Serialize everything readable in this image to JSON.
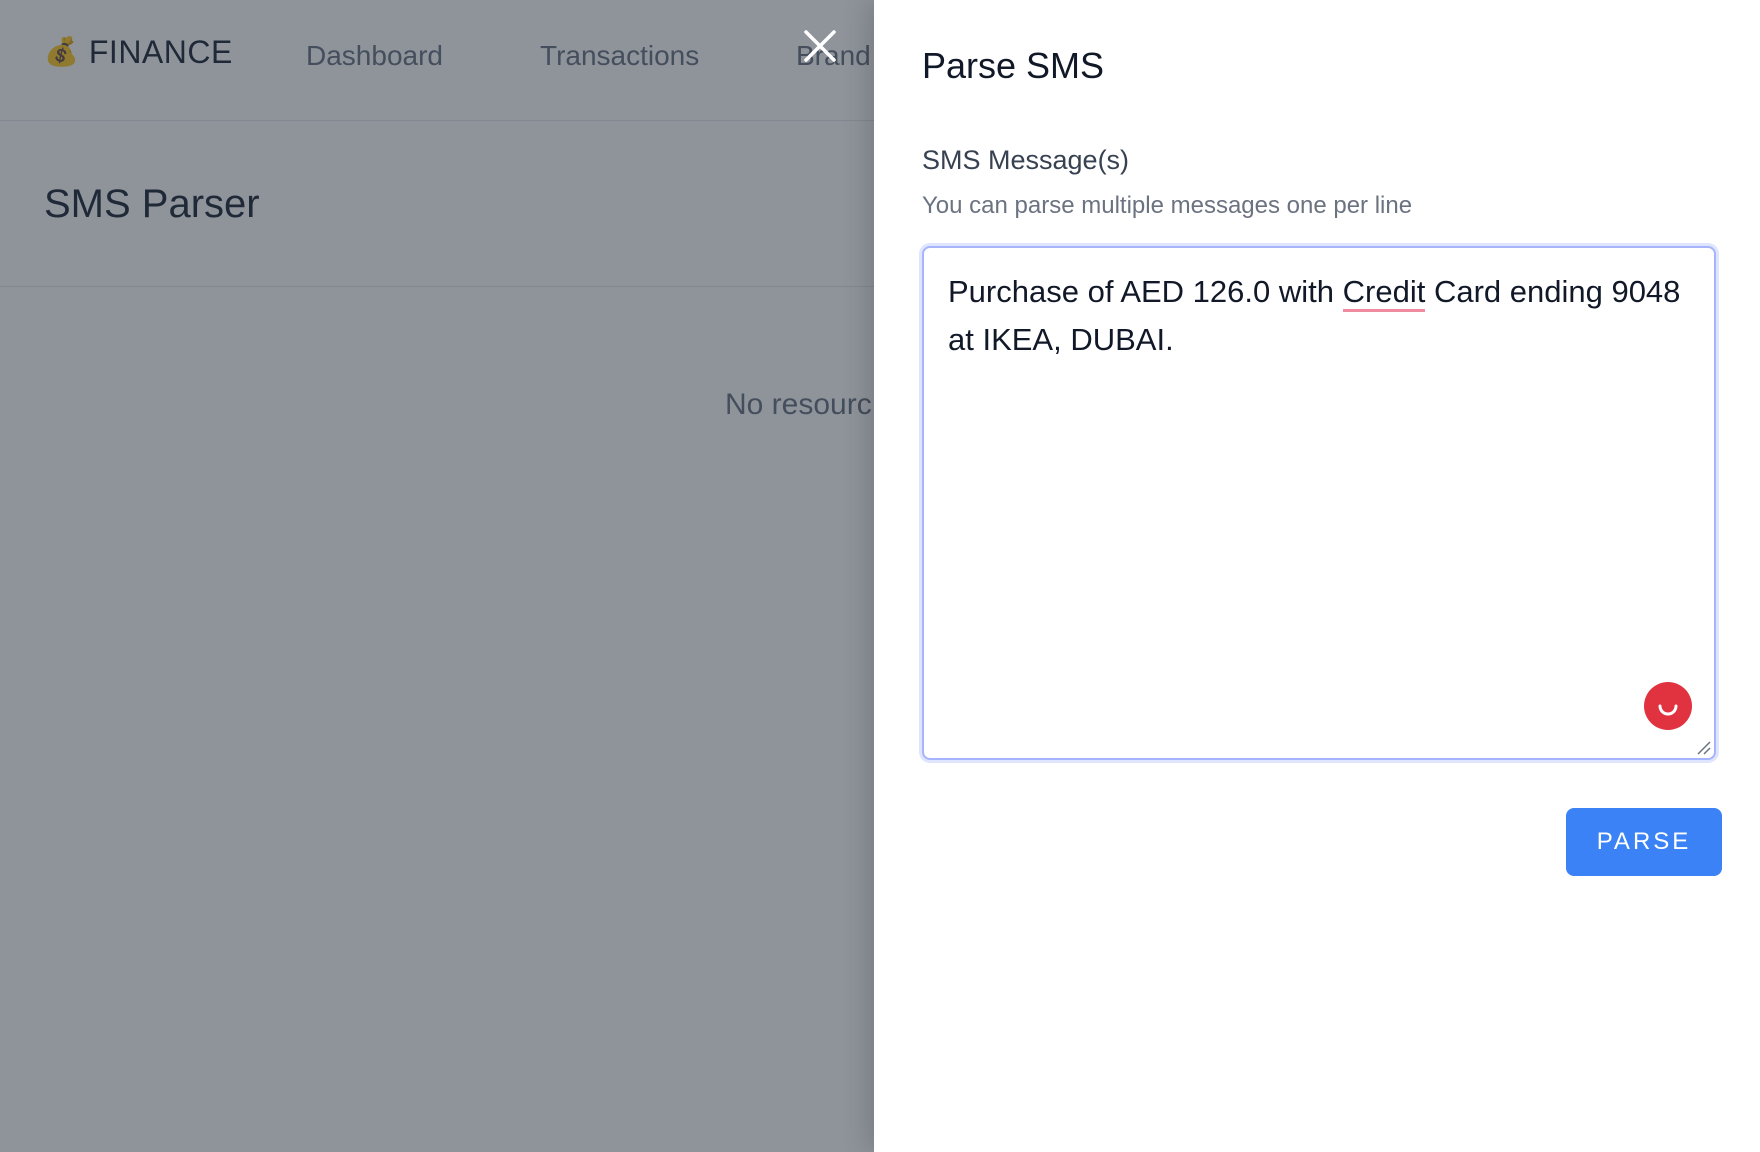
{
  "app": {
    "brand": {
      "logo_icon": "money-bag-icon",
      "logo_glyph": "💰",
      "name": "FINANCE"
    },
    "nav": [
      {
        "label": "Dashboard"
      },
      {
        "label": "Transactions"
      },
      {
        "label": "Brand"
      }
    ],
    "page_title": "SMS Parser",
    "empty_message": "No resourc"
  },
  "overlay": {
    "color": "#1f2937",
    "opacity": 0.5
  },
  "drawer": {
    "close_icon": "close-icon",
    "title": "Parse SMS",
    "field": {
      "label": "SMS Message(s)",
      "hint": "You can parse multiple messages one per line",
      "value_before": "Purchase of AED 126.0 with ",
      "value_misspelled": "Credit",
      "value_after": " Card ending 9048 at IKEA, DUBAI."
    },
    "extension_icon": "grammarly-icon",
    "submit_label": "PARSE",
    "accent": "#3b82f6"
  }
}
